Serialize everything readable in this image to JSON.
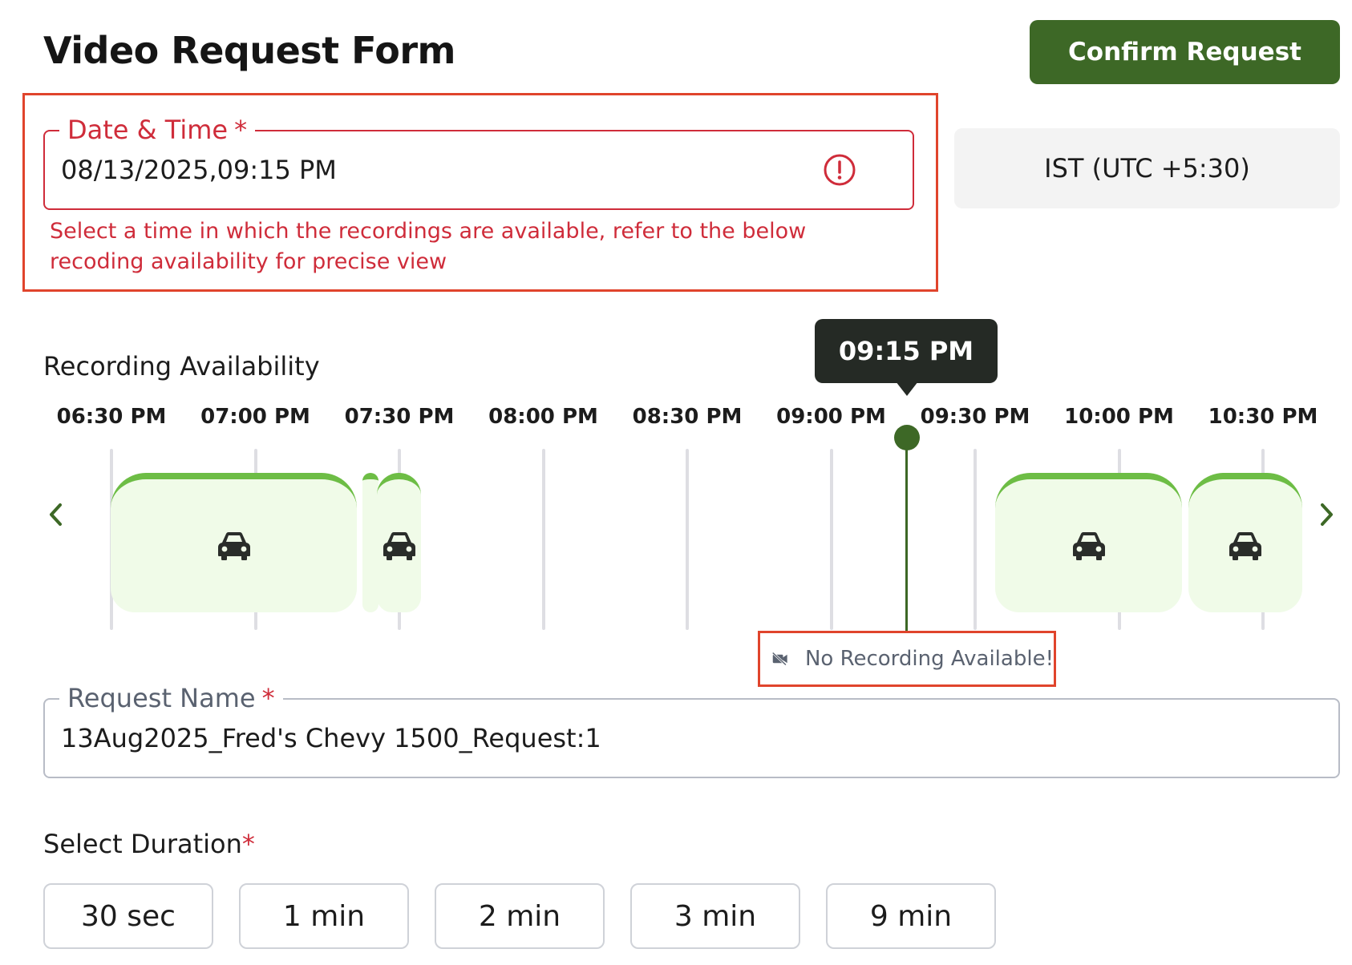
{
  "header": {
    "title": "Video Request Form",
    "confirm_label": "Confirm Request"
  },
  "datetime": {
    "label": "Date & Time",
    "required_mark": "*",
    "value": "08/13/2025,09:15 PM",
    "error_icon": "alert-circle-icon",
    "error_message": "Select a time in which the recordings are available, refer to the below recoding availability for precise view",
    "timezone": "IST (UTC +5:30)"
  },
  "recording": {
    "title": "Recording Availability",
    "ticks": [
      "06:30 PM",
      "07:00 PM",
      "07:30 PM",
      "08:00 PM",
      "08:30 PM",
      "09:00 PM",
      "09:30 PM",
      "10:00 PM",
      "10:30 PM"
    ],
    "selected_time": "09:15 PM",
    "no_recording_message": "No Recording Available!",
    "no_recording_icon": "video-off-icon",
    "segment_icon": "car-icon",
    "prev_icon": "chevron-left-icon",
    "next_icon": "chevron-right-icon"
  },
  "request_name": {
    "label": "Request Name",
    "required_mark": "*",
    "value": "13Aug2025_Fred's Chevy 1500_Request:1"
  },
  "duration": {
    "label": "Select Duration",
    "required_mark": "*",
    "options": [
      "30 sec",
      "1 min",
      "2 min",
      "3 min",
      "9 min"
    ]
  },
  "colors": {
    "brand_green": "#3d6826",
    "segment_fill": "#f0fbe8",
    "segment_top": "#6dbd45",
    "error_red": "#cf2c3a",
    "highlight_red": "#e0442c"
  }
}
